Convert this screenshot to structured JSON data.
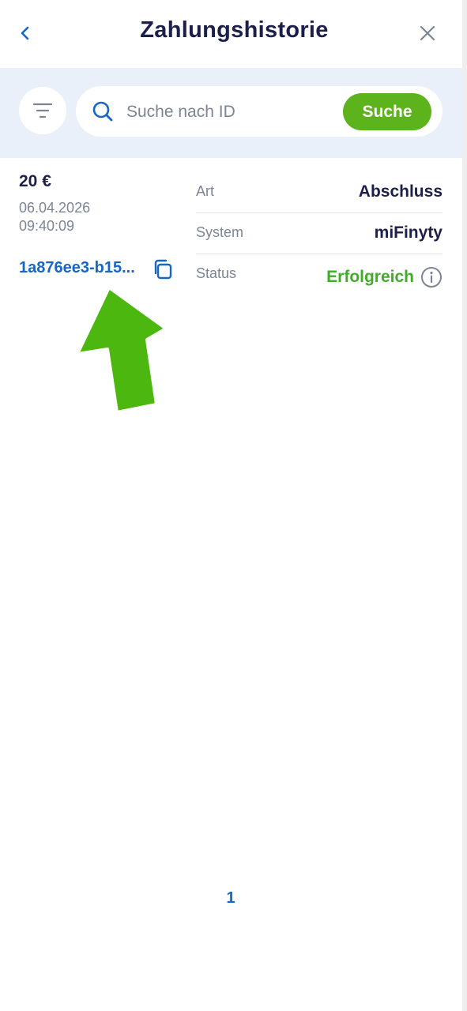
{
  "header": {
    "title": "Zahlungshistorie",
    "back_icon": "chevron-left-icon",
    "close_icon": "close-icon"
  },
  "search": {
    "placeholder": "Suche nach ID",
    "value": "",
    "button_label": "Suche",
    "filter_icon": "filter-icon",
    "search_icon": "search-icon"
  },
  "transaction": {
    "amount": "20 €",
    "date": "06.04.2026",
    "time": "09:40:09",
    "id_short": "1a876ee3-b15...",
    "copy_icon": "copy-icon",
    "details": [
      {
        "label": "Art",
        "value": "Abschluss"
      },
      {
        "label": "System",
        "value": "miFinyty"
      },
      {
        "label": "Status",
        "value": "Erfolgreich"
      }
    ],
    "info_icon": "info-icon"
  },
  "annotation": {
    "arrow_icon": "green-arrow-icon"
  },
  "pagination": {
    "current_page": "1"
  },
  "colors": {
    "brand_dark": "#1c1f4a",
    "link_blue": "#1666c5",
    "accent_green": "#5cb31b",
    "success_green": "#3fae26",
    "search_bg": "#eaf0f9",
    "muted": "#7d8595"
  }
}
